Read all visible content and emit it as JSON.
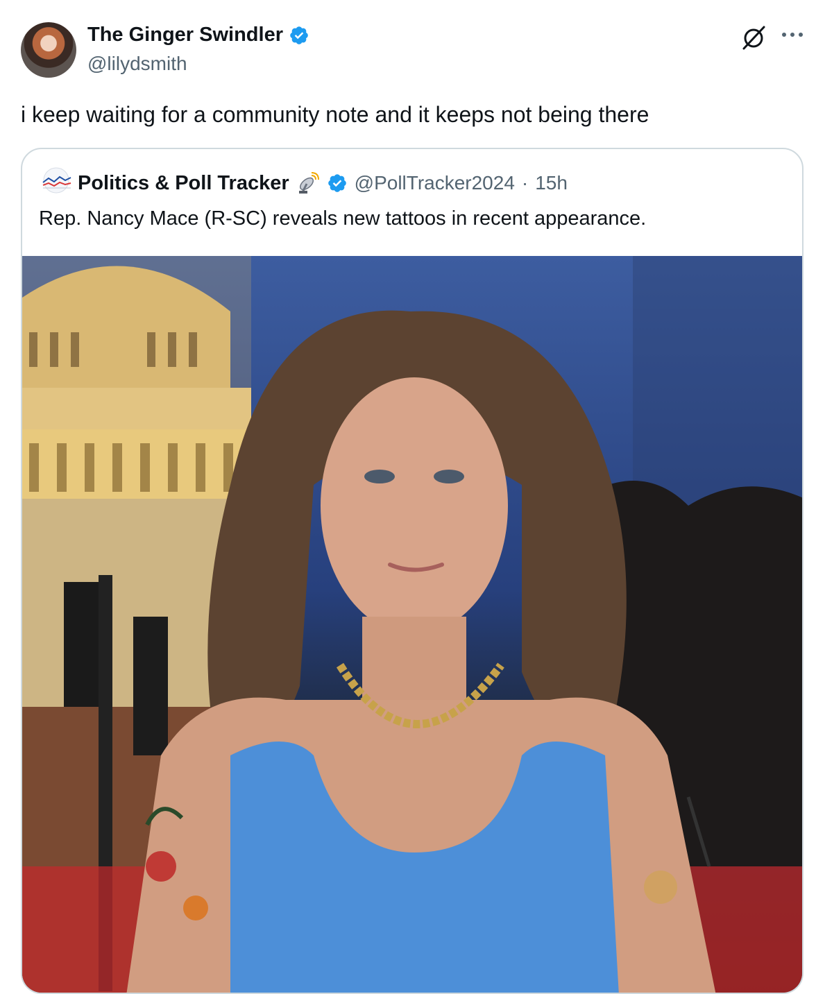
{
  "author": {
    "name": "The Ginger Swindler",
    "handle": "@lilydsmith",
    "verified": true
  },
  "tweet": {
    "text": "i keep waiting for a community note and it keeps not being there"
  },
  "quoted": {
    "name": "Politics & Poll Tracker",
    "emoji_icon": "satellite-antenna-icon",
    "verified": true,
    "handle": "@PollTracker2024",
    "separator": "·",
    "time": "15h",
    "text": "Rep. Nancy Mace (R-SC) reveals new tattoos in recent appearance."
  },
  "icons": {
    "grok": "grok-icon",
    "more": "more-options-icon"
  },
  "colors": {
    "verified_blue": "#1d9bf0",
    "secondary_text": "#536471",
    "border": "#cfd9de"
  }
}
